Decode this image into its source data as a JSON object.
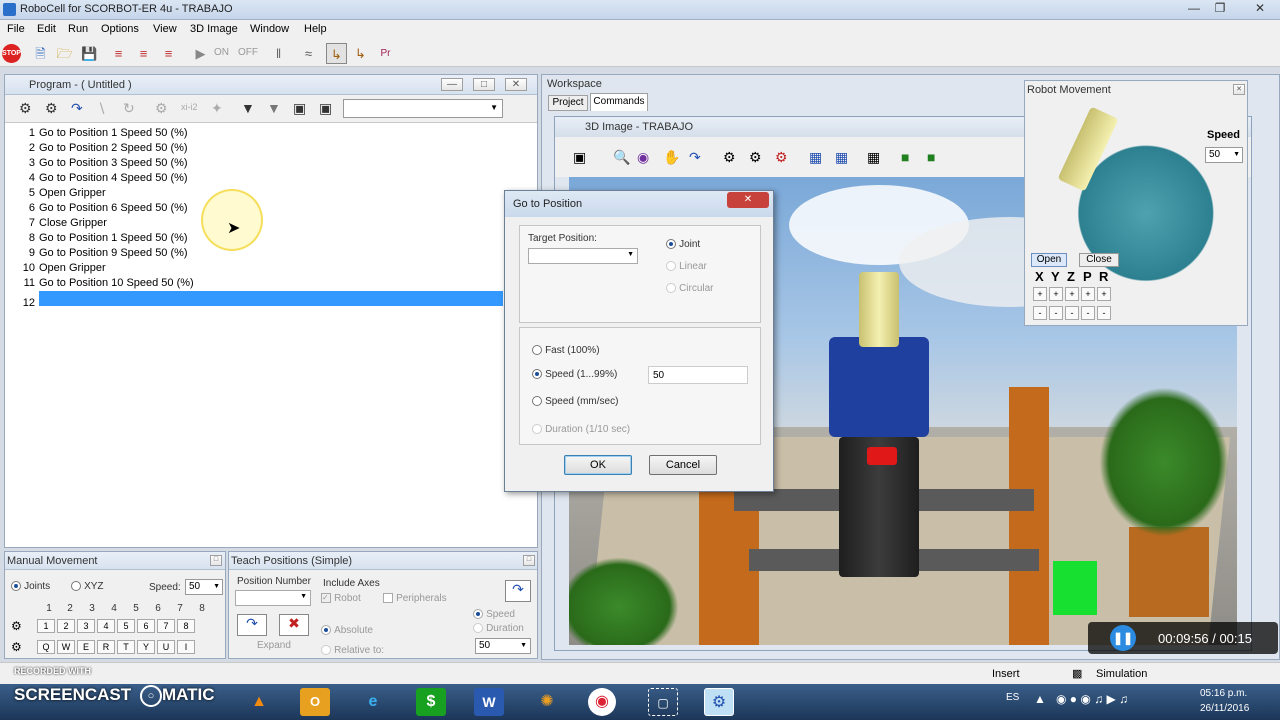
{
  "window": {
    "title": "RoboCell for SCORBOT-ER 4u - TRABAJO"
  },
  "menu": [
    "File",
    "Edit",
    "Run",
    "Options",
    "View",
    "3D Image",
    "Window",
    "Help"
  ],
  "toolbar": {
    "on_label": "ON",
    "off_label": "OFF"
  },
  "program": {
    "title": "Program -  ( Untitled )",
    "lines": [
      {
        "n": "1",
        "text": "Go to Position 1 Speed 50 (%)"
      },
      {
        "n": "2",
        "text": "Go to Position 2 Speed 50 (%)"
      },
      {
        "n": "3",
        "text": "Go to Position 3 Speed 50 (%)"
      },
      {
        "n": "4",
        "text": "Go to Position 4 Speed 50 (%)"
      },
      {
        "n": "5",
        "text": "Open Gripper"
      },
      {
        "n": "6",
        "text": "Go to Position 6 Speed 50 (%)"
      },
      {
        "n": "7",
        "text": "Close Gripper"
      },
      {
        "n": "8",
        "text": "Go to Position 1 Speed 50 (%)"
      },
      {
        "n": "9",
        "text": "Go to Position 9 Speed 50 (%)"
      },
      {
        "n": "10",
        "text": "Open Gripper"
      },
      {
        "n": "11",
        "text": "Go to Position 10 Speed 50 (%)"
      },
      {
        "n": "12",
        "text": ""
      }
    ]
  },
  "workspace": {
    "title": "Workspace",
    "tabs": [
      "Project",
      "Commands"
    ],
    "image_title": "3D Image -  TRABAJO"
  },
  "dialog": {
    "title": "Go to Position",
    "target_label": "Target Position:",
    "joint": "Joint",
    "linear": "Linear",
    "circular": "Circular",
    "fast": "Fast (100%)",
    "speed": "Speed (1...99%)",
    "speed_value": "50",
    "speed_mm": "Speed (mm/sec)",
    "duration": "Duration (1/10 sec)",
    "ok": "OK",
    "cancel": "Cancel"
  },
  "robot_movement": {
    "title": "Robot Movement",
    "speed_label": "Speed",
    "speed_value": "50",
    "open": "Open",
    "close": "Close",
    "axes": [
      "X",
      "Y",
      "Z",
      "P",
      "R"
    ]
  },
  "manual": {
    "title": "Manual Movement",
    "joints": "Joints",
    "xyz": "XYZ",
    "speed_label": "Speed:",
    "speed_value": "50",
    "nums": [
      "1",
      "2",
      "3",
      "4",
      "5",
      "6",
      "7",
      "8"
    ],
    "minus_keys": [
      "1",
      "2",
      "3",
      "4",
      "5",
      "6",
      "7",
      "8"
    ],
    "letter_keys": [
      "Q",
      "W",
      "E",
      "R",
      "T",
      "Y",
      "U",
      "I"
    ]
  },
  "teach": {
    "title": "Teach Positions (Simple)",
    "position_number": "Position Number",
    "include_axes": "Include Axes",
    "robot": "Robot",
    "peripherals": "Peripherals",
    "absolute": "Absolute",
    "relative": "Relative to:",
    "expand": "Expand",
    "speed": "Speed",
    "duration": "Duration",
    "speed_value": "50"
  },
  "status": {
    "mode": "Insert",
    "simulation": "Simulation"
  },
  "recording": {
    "recorded_with": "RECORDED WITH",
    "brand": "SCREENCAST",
    "brand2": "MATIC",
    "time": "00:09:56 / 00:15"
  },
  "tray": {
    "lang": "ES",
    "time": "05:16 p.m.",
    "date": "26/11/2016"
  }
}
